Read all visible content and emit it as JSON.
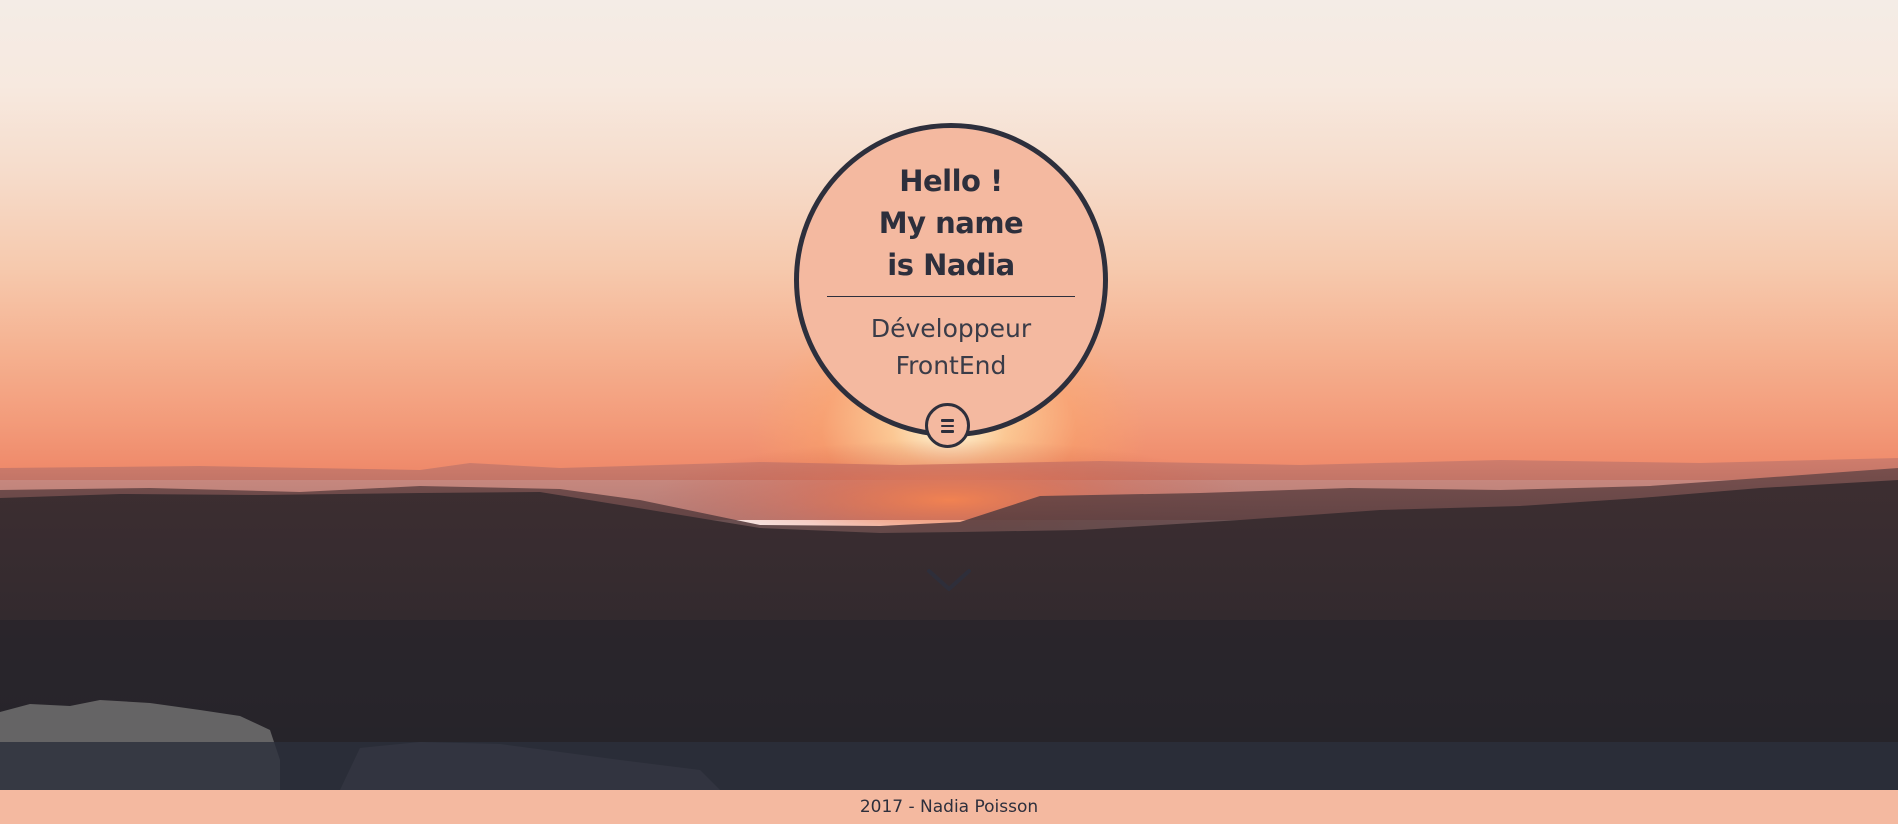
{
  "profile": {
    "greeting_lines": [
      "Hello !",
      "My name",
      "is Nadia"
    ],
    "role_lines": [
      "Développeur",
      "FrontEnd"
    ]
  },
  "icons": {
    "menu": "hamburger-menu-icon",
    "scroll": "chevron-down-icon"
  },
  "footer": {
    "text": "2017 - Nadia Poisson"
  },
  "colors": {
    "accent": "#f4b9a0",
    "dark": "#2d2f3c"
  }
}
